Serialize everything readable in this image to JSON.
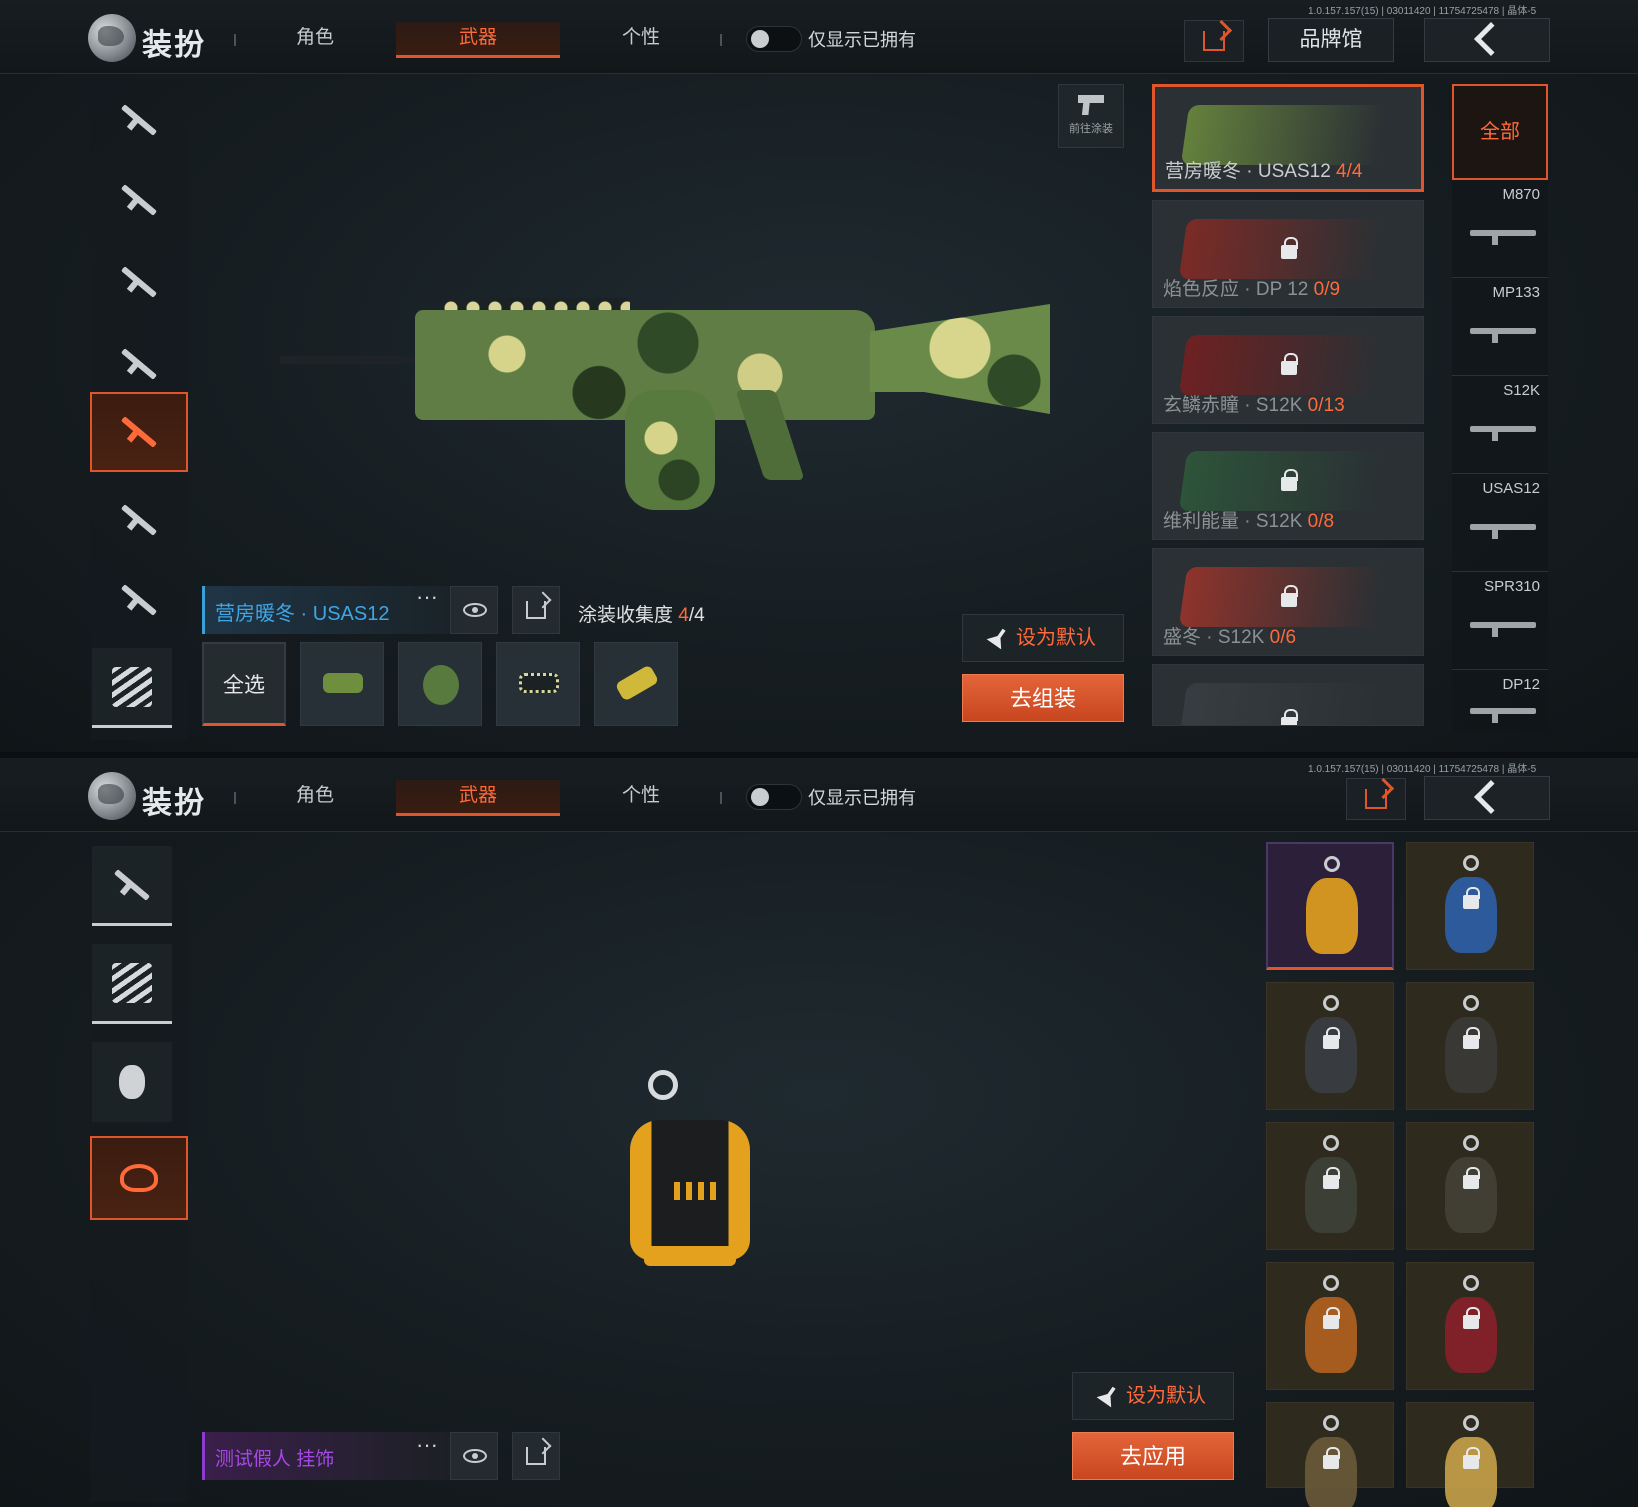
{
  "panel1": {
    "header": {
      "title": "装扮",
      "tabs": [
        {
          "label": "角色",
          "active": false
        },
        {
          "label": "武器",
          "active": true
        },
        {
          "label": "个性",
          "active": false
        }
      ],
      "owned_only_label": "仅显示已拥有",
      "version": "1.0.157.157(15) | 03011420 | 11754725478 | 晶体-5",
      "brand_hall_label": "品牌馆"
    },
    "goto_paint_label": "前往涂装",
    "skin": {
      "name": "营房暖冬 · USAS12",
      "more": "···",
      "collect_label": "涂装收集度",
      "collect_current": "4",
      "collect_total": "/4"
    },
    "select_all_label": "全选",
    "set_default_label": "设为默认",
    "assemble_label": "去组装",
    "skin_list": [
      {
        "name": "营房暖冬 · USAS12 ",
        "count": "4/4",
        "locked": false,
        "color": "#6f8f3f"
      },
      {
        "name": "焰色反应 · DP 12 ",
        "count": "0/9",
        "locked": true,
        "color": "#8a2a24"
      },
      {
        "name": "玄鳞赤瞳 · S12K ",
        "count": "0/13",
        "locked": true,
        "color": "#7a1e1e"
      },
      {
        "name": "维利能量 · S12K ",
        "count": "0/8",
        "locked": true,
        "color": "#2e5a3a"
      },
      {
        "name": "盛冬 · S12K ",
        "count": "0/6",
        "locked": true,
        "color": "#a0342a"
      },
      {
        "name": "",
        "count": "",
        "locked": true,
        "color": "#3a3f44"
      }
    ],
    "type_filter": {
      "all_label": "全部",
      "types": [
        "M870",
        "MP133",
        "S12K",
        "USAS12",
        "SPR310",
        "DP12"
      ]
    }
  },
  "panel2": {
    "header": {
      "title": "装扮",
      "tabs": [
        {
          "label": "角色",
          "active": false
        },
        {
          "label": "武器",
          "active": true
        },
        {
          "label": "个性",
          "active": false
        }
      ],
      "owned_only_label": "仅显示已拥有",
      "version": "1.0.157.157(15) | 03011420 | 11754725478 | 晶体-5"
    },
    "charm": {
      "name": "测试假人 挂饰",
      "more": "···"
    },
    "set_default_label": "设为默认",
    "apply_label": "去应用",
    "charm_grid": [
      {
        "color": "#e3a11e",
        "active": true,
        "locked": false
      },
      {
        "color": "#2c5fa8",
        "active": false,
        "locked": true
      },
      {
        "color": "#3a3d42",
        "active": false,
        "locked": true
      },
      {
        "color": "#3b3a36",
        "active": false,
        "locked": true
      },
      {
        "color": "#3d4138",
        "active": false,
        "locked": true
      },
      {
        "color": "#444035",
        "active": false,
        "locked": true
      },
      {
        "color": "#b5621f",
        "active": false,
        "locked": true
      },
      {
        "color": "#8a1f2a",
        "active": false,
        "locked": true
      },
      {
        "color": "#6b5a3a",
        "active": false,
        "locked": true
      },
      {
        "color": "#c9a24a",
        "active": false,
        "locked": true
      }
    ]
  }
}
